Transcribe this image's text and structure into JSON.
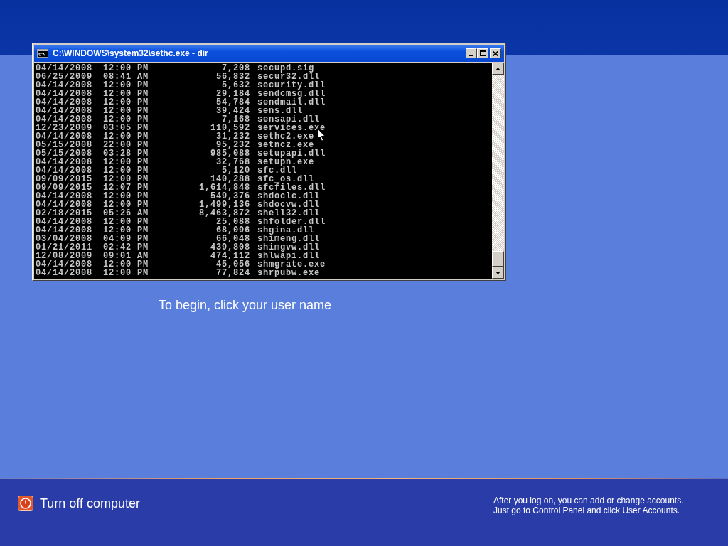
{
  "console_window": {
    "title": "C:\\WINDOWS\\system32\\sethc.exe - dir",
    "lines": [
      {
        "date": "04/14/2008",
        "time": "12:00 PM",
        "size": "7,208",
        "name": "secupd.sig"
      },
      {
        "date": "06/25/2009",
        "time": "08:41 AM",
        "size": "56,832",
        "name": "secur32.dll"
      },
      {
        "date": "04/14/2008",
        "time": "12:00 PM",
        "size": "5,632",
        "name": "security.dll"
      },
      {
        "date": "04/14/2008",
        "time": "12:00 PM",
        "size": "29,184",
        "name": "sendcmsg.dll"
      },
      {
        "date": "04/14/2008",
        "time": "12:00 PM",
        "size": "54,784",
        "name": "sendmail.dll"
      },
      {
        "date": "04/14/2008",
        "time": "12:00 PM",
        "size": "39,424",
        "name": "sens.dll"
      },
      {
        "date": "04/14/2008",
        "time": "12:00 PM",
        "size": "7,168",
        "name": "sensapi.dll"
      },
      {
        "date": "12/23/2009",
        "time": "03:05 PM",
        "size": "110,592",
        "name": "services.exe"
      },
      {
        "date": "04/14/2008",
        "time": "12:00 PM",
        "size": "31,232",
        "name": "sethc2.exe"
      },
      {
        "date": "05/15/2008",
        "time": "22:00 PM",
        "size": "95,232",
        "name": "setncz.exe"
      },
      {
        "date": "05/15/2008",
        "time": "03:28 PM",
        "size": "985,088",
        "name": "setupapi.dll"
      },
      {
        "date": "04/14/2008",
        "time": "12:00 PM",
        "size": "32,768",
        "name": "setupn.exe"
      },
      {
        "date": "04/14/2008",
        "time": "12:00 PM",
        "size": "5,120",
        "name": "sfc.dll"
      },
      {
        "date": "09/09/2015",
        "time": "12:00 PM",
        "size": "140,288",
        "name": "sfc_os.dll"
      },
      {
        "date": "09/09/2015",
        "time": "12:07 PM",
        "size": "1,614,848",
        "name": "sfcfiles.dll"
      },
      {
        "date": "04/14/2008",
        "time": "12:00 PM",
        "size": "549,376",
        "name": "shdoclc.dll"
      },
      {
        "date": "04/14/2008",
        "time": "12:00 PM",
        "size": "1,499,136",
        "name": "shdocvw.dll"
      },
      {
        "date": "02/18/2015",
        "time": "05:26 AM",
        "size": "8,463,872",
        "name": "shell32.dll"
      },
      {
        "date": "04/14/2008",
        "time": "12:00 PM",
        "size": "25,088",
        "name": "shfolder.dll"
      },
      {
        "date": "04/14/2008",
        "time": "12:00 PM",
        "size": "68,096",
        "name": "shgina.dll"
      },
      {
        "date": "03/04/2008",
        "time": "04:09 PM",
        "size": "66,048",
        "name": "shimeng.dll"
      },
      {
        "date": "01/21/2011",
        "time": "02:42 PM",
        "size": "439,808",
        "name": "shimgvw.dll"
      },
      {
        "date": "12/08/2009",
        "time": "09:01 AM",
        "size": "474,112",
        "name": "shlwapi.dll"
      },
      {
        "date": "04/14/2008",
        "time": "12:00 PM",
        "size": "45,056",
        "name": "shmgrate.exe"
      },
      {
        "date": "04/14/2008",
        "time": "12:00 PM",
        "size": "77,824",
        "name": "shrpubw.exe"
      }
    ]
  },
  "welcome": {
    "instruction": "To begin, click your user name"
  },
  "bottom_bar": {
    "turn_off": "Turn off computer",
    "hint_lines": [
      "After you log on, you can add or change accounts.",
      "Just go to Control Panel and click User Accounts."
    ]
  }
}
